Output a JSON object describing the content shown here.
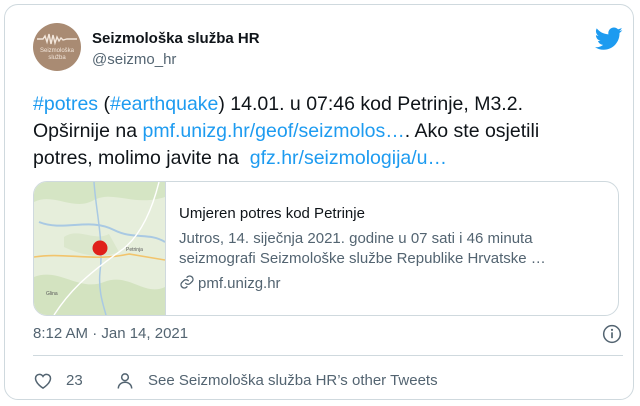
{
  "account": {
    "display_name": "Seizmološka služba HR",
    "handle": "@seizmo_hr",
    "avatar_line1": "Seizmološka",
    "avatar_line2": "služba"
  },
  "tweet": {
    "hashtag1": "#potres",
    "paren_open": " (",
    "hashtag2": "#earthquake",
    "text_line1": ") 14.01. u 07:46 kod Petrinje, M3.2.",
    "text_line2_prefix": "Opširnije na ",
    "link1": "pmf.unizg.hr/geof/seizmolos…",
    "text_line2_suffix": ". Ako ste osjetili",
    "text_line3_prefix": "potres, molimo javite na  ",
    "link2": "gfz.hr/seizmologija/u…"
  },
  "link_card": {
    "title": "Umjeren potres kod Petrinje",
    "description_line1": "Jutros, 14. siječnja 2021. godine u 07 sati i 46 minuta",
    "description_line2": "seizmografi Seizmološke službe Republike Hrvatske …",
    "url": "pmf.unizg.hr",
    "map_labels": {
      "petrinja": "Petrinja",
      "glina": "Glina"
    }
  },
  "meta": {
    "timestamp": "8:12 AM · Jan 14, 2021"
  },
  "actions": {
    "like_count": "23",
    "other_tweets": "See Seizmološka služba HR’s other Tweets"
  },
  "colors": {
    "twitter_blue": "#1d9bf0",
    "like_red": "#f91880",
    "epicenter": "#e0201a",
    "text_secondary": "#536471"
  },
  "icons": [
    "twitter-bird-icon",
    "link-icon",
    "info-icon",
    "heart-icon",
    "person-icon"
  ]
}
